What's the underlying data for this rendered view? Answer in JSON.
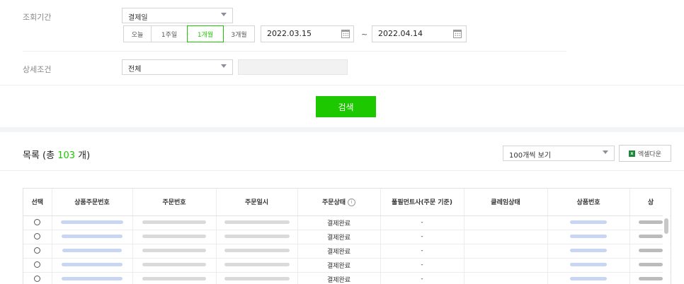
{
  "filters": {
    "period_label": "조회기간",
    "period_type_selected": "결제일",
    "period_buttons": [
      "오늘",
      "1주일",
      "1개월",
      "3개월"
    ],
    "period_active": "1개월",
    "start_date": "2022.03.15",
    "end_date": "2022.04.14",
    "date_separator": "~",
    "detail_label": "상세조건",
    "detail_selected": "전체",
    "search_button": "검색"
  },
  "list": {
    "title_prefix": "목록 (총 ",
    "total_count": "103",
    "title_suffix": " 개)",
    "page_size_selected": "100개씩 보기",
    "excel_button": "엑셀다운",
    "columns": [
      "선택",
      "상품주문번호",
      "주문번호",
      "주문일시",
      "주문상태",
      "풀필먼트사(주문 기준)",
      "클레임상태",
      "상품번호",
      "상"
    ],
    "rows": [
      {
        "status": "결제완료",
        "fulfillment": "-"
      },
      {
        "status": "결제완료",
        "fulfillment": "-"
      },
      {
        "status": "결제완료",
        "fulfillment": "-"
      },
      {
        "status": "결제완료",
        "fulfillment": "-"
      },
      {
        "status": "결제완료",
        "fulfillment": "-"
      }
    ]
  },
  "colors": {
    "accent": "#1ec800",
    "link_blur": "#c8d6f3"
  },
  "icons": [
    "chevron-down-icon",
    "calendar-icon",
    "info-icon",
    "excel-icon",
    "radio-icon"
  ]
}
